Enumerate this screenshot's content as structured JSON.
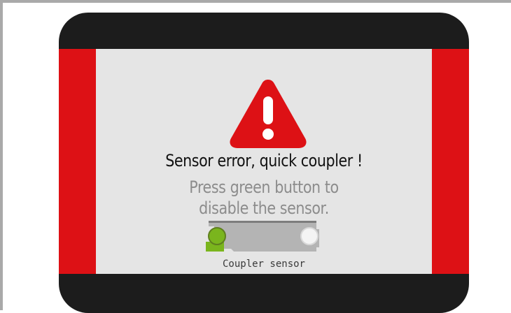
{
  "alert": {
    "title": "Sensor error, quick coupler !",
    "message_line1": "Press green button to",
    "message_line2": "disable the sensor."
  },
  "sensor": {
    "label": "Coupler sensor",
    "left_indicator_color": "#7ab51d",
    "right_indicator_color": "#f2f2f2"
  },
  "colors": {
    "warning_red": "#dd1115",
    "bezel": "#1c1c1c",
    "panel": "#e5e5e5"
  },
  "icons": {
    "warning": "warning-triangle-icon"
  }
}
